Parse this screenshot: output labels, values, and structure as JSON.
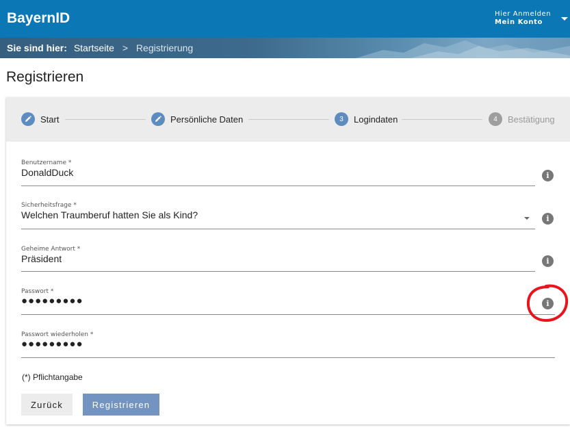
{
  "header": {
    "brand": "BayernID",
    "account_line1": "Hier Anmelden",
    "account_line2": "Mein Konto"
  },
  "breadcrumb": {
    "label": "Sie sind hier:",
    "items": [
      "Startseite",
      "Registrierung"
    ],
    "separator": ">"
  },
  "page": {
    "title": "Registrieren"
  },
  "steps": [
    {
      "label": "Start",
      "marker": "pencil-icon",
      "state": "done"
    },
    {
      "label": "Persönliche Daten",
      "marker": "pencil-icon",
      "state": "done"
    },
    {
      "label": "Logindaten",
      "marker": "3",
      "state": "active"
    },
    {
      "label": "Bestätigung",
      "marker": "4",
      "state": "disabled"
    }
  ],
  "form": {
    "username": {
      "label": "Benutzername *",
      "value": "DonaldDuck"
    },
    "question": {
      "label": "Sicherheitsfrage *",
      "value": "Welchen Traumberuf hatten Sie als Kind?"
    },
    "answer": {
      "label": "Geheime Antwort *",
      "value": "Präsident"
    },
    "password": {
      "label": "Passwort *",
      "value": "●●●●●●●●●"
    },
    "password_repeat": {
      "label": "Passwort wiederholen *",
      "value": "●●●●●●●●●"
    },
    "info_glyph": "i",
    "required_note": "(*) Pflichtangabe"
  },
  "buttons": {
    "back": "Zurück",
    "submit": "Registrieren"
  },
  "colors": {
    "header_bg": "#0c77b5",
    "step_active": "#5d8cc0",
    "step_disabled": "#9e9e9e",
    "submit_bg": "#7393c0",
    "annotation": "#e8141e"
  }
}
